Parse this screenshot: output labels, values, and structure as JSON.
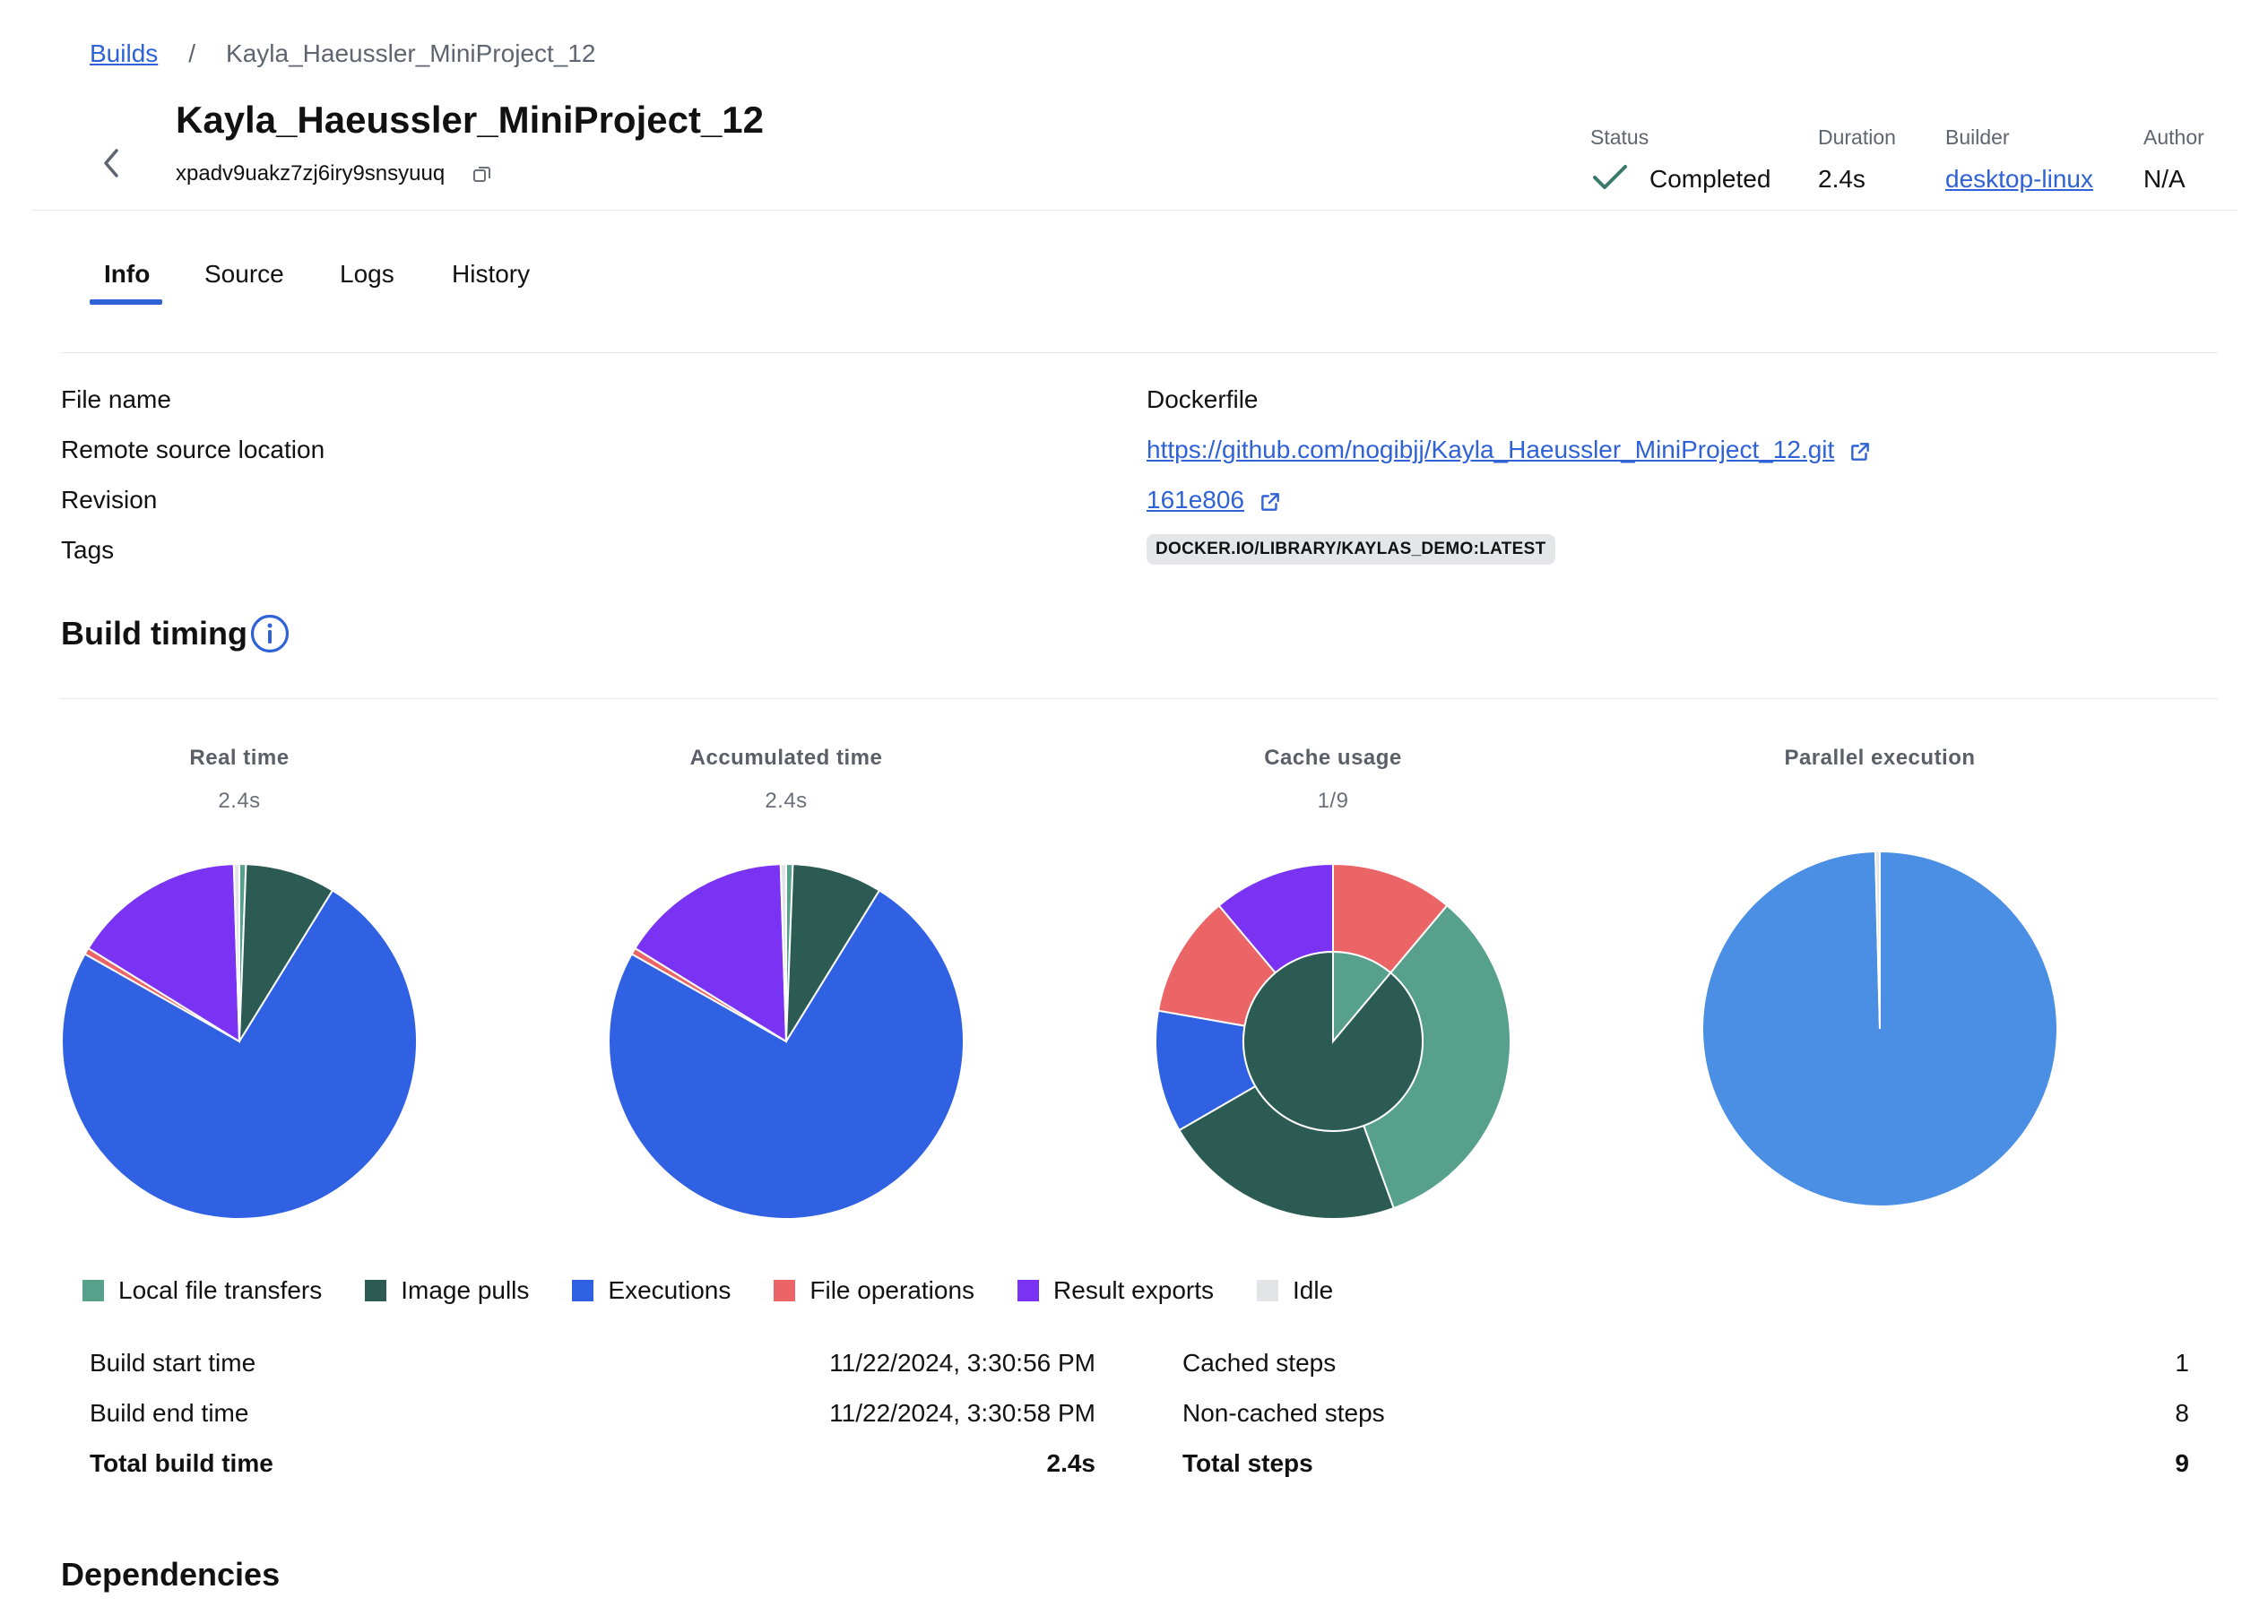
{
  "breadcrumb": {
    "root": "Builds",
    "separator": "/",
    "current": "Kayla_Haeussler_MiniProject_12"
  },
  "header": {
    "title": "Kayla_Haeussler_MiniProject_12",
    "build_id": "xpadv9uakz7zj6iry9snsyuuq",
    "status_label": "Status",
    "status_value": "Completed",
    "duration_label": "Duration",
    "duration_value": "2.4s",
    "builder_label": "Builder",
    "builder_value": "desktop-linux",
    "author_label": "Author",
    "author_value": "N/A"
  },
  "tabs": [
    {
      "label": "Info",
      "active": true
    },
    {
      "label": "Source",
      "active": false
    },
    {
      "label": "Logs",
      "active": false
    },
    {
      "label": "History",
      "active": false
    }
  ],
  "info": {
    "file_name_label": "File name",
    "file_name_value": "Dockerfile",
    "remote_label": "Remote source location",
    "remote_value": "https://github.com/nogibjj/Kayla_Haeussler_MiniProject_12.git",
    "revision_label": "Revision",
    "revision_value": "161e806",
    "tags_label": "Tags",
    "tags_value": "DOCKER.IO/LIBRARY/KAYLAS_DEMO:LATEST"
  },
  "build_timing": {
    "title": "Build timing"
  },
  "colors": {
    "local_file_transfers": "#56a08c",
    "image_pulls": "#2b5b52",
    "executions": "#3061e3",
    "file_operations": "#eb6567",
    "result_exports": "#7a33f2",
    "idle": "#e3e4e8",
    "parallel": "#4a8fe3",
    "accent": "#2f62d6",
    "status_check": "#3b7a6b"
  },
  "chart_data": [
    {
      "type": "pie",
      "title": "Real time",
      "subtitle": "2.4s",
      "categories": [
        "Local file transfers",
        "Image pulls",
        "Executions",
        "File operations",
        "Result exports",
        "Idle"
      ],
      "values": [
        0.6,
        8.2,
        74.4,
        0.6,
        15.7,
        0.5
      ]
    },
    {
      "type": "pie",
      "title": "Accumulated time",
      "subtitle": "2.4s",
      "categories": [
        "Local file transfers",
        "Image pulls",
        "Executions",
        "File operations",
        "Result exports",
        "Idle"
      ],
      "values": [
        0.6,
        8.2,
        74.4,
        0.6,
        15.7,
        0.5
      ]
    },
    {
      "type": "pie",
      "title": "Cache usage",
      "subtitle": "1/9",
      "inner": {
        "categories": [
          "Cached steps",
          "Non-cached steps"
        ],
        "values": [
          1,
          8
        ]
      },
      "outer": {
        "categories": [
          "File operations",
          "Local file transfers",
          "Image pulls",
          "Executions",
          "File operations",
          "Result exports"
        ],
        "values": [
          1,
          3,
          2,
          1,
          1,
          1
        ]
      }
    },
    {
      "type": "pie",
      "title": "Parallel execution",
      "subtitle": "",
      "values": [
        99.6,
        0.4
      ]
    }
  ],
  "legend": [
    {
      "label": "Local file transfers",
      "color": "#56a08c"
    },
    {
      "label": "Image pulls",
      "color": "#2b5b52"
    },
    {
      "label": "Executions",
      "color": "#3061e3"
    },
    {
      "label": "File operations",
      "color": "#eb6567"
    },
    {
      "label": "Result exports",
      "color": "#7a33f2"
    },
    {
      "label": "Idle",
      "color": "#e3e4e8"
    }
  ],
  "summary": {
    "start_label": "Build start time",
    "start_value": "11/22/2024, 3:30:56 PM",
    "end_label": "Build end time",
    "end_value": "11/22/2024, 3:30:58 PM",
    "total_label": "Total build time",
    "total_value": "2.4s",
    "cached_label": "Cached steps",
    "cached_value": "1",
    "noncached_label": "Non-cached steps",
    "noncached_value": "8",
    "steps_label": "Total steps",
    "steps_value": "9"
  },
  "dependencies": {
    "title": "Dependencies"
  }
}
